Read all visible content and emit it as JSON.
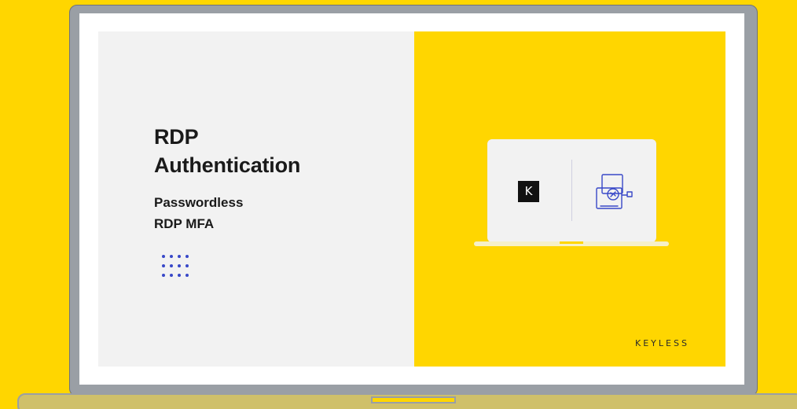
{
  "slide": {
    "title_line1": "RDP",
    "title_line2": "Authentication",
    "subtitle_line1": "Passwordless",
    "subtitle_line2": "RDP MFA",
    "brand": "KEYLESS"
  },
  "illustration": {
    "logo_glyph": "K",
    "icons": [
      "keyless-logo-icon",
      "remote-desktop-icon"
    ]
  },
  "colors": {
    "background": "#FFD600",
    "panel": "#F2F2F2",
    "accent_dots": "#3848C8",
    "laptop_frame": "#9A9FA5"
  }
}
